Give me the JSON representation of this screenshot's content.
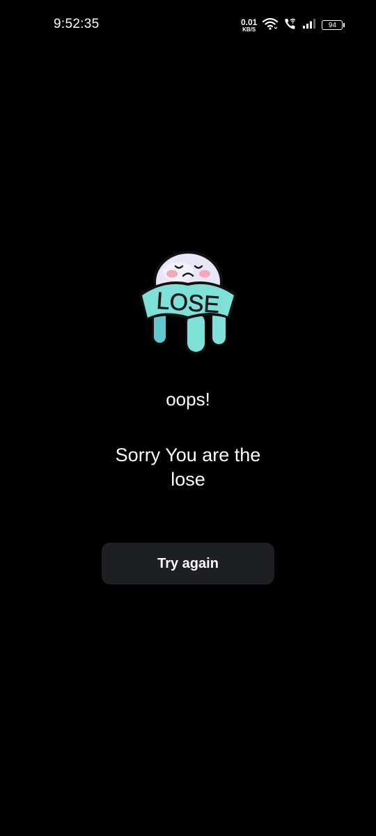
{
  "status_bar": {
    "time": "9:52:35",
    "net_speed_value": "0.01",
    "net_speed_unit": "KB/S",
    "battery_level": "94",
    "icons": [
      "wifi-icon",
      "wifi-call-icon",
      "signal-icon",
      "battery-icon"
    ]
  },
  "illustration": {
    "icon": "lose-ghost-icon",
    "banner_text": "LOSE",
    "colors": {
      "banner": "#7fe0d8",
      "body": "#e9e6f7",
      "cheeks": "#f4a9b8"
    }
  },
  "main": {
    "title": "oops!",
    "message": "Sorry You are the lose",
    "button_label": "Try again"
  },
  "colors": {
    "background": "#000000",
    "button_bg": "#1e1f22",
    "text": "#ffffff"
  }
}
